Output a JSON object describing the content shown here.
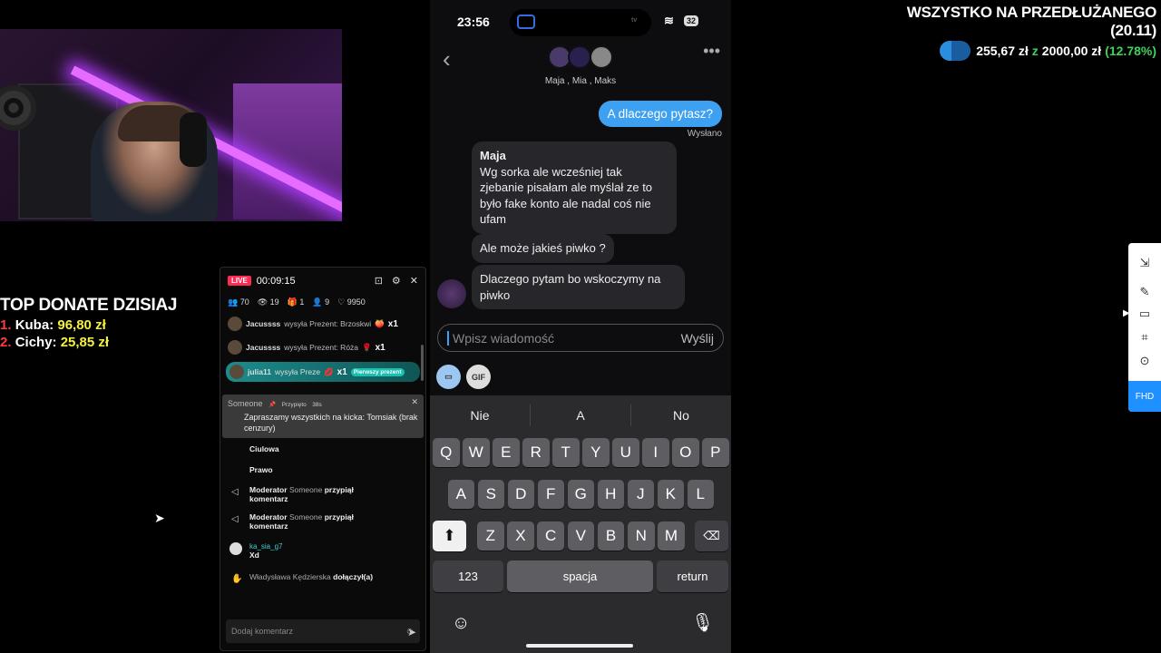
{
  "donate": {
    "title": "TOP DONATE DZISIAJ",
    "entries": [
      {
        "rank": "1.",
        "name": "Kuba:",
        "amount": "96,80 zł"
      },
      {
        "rank": "2.",
        "name": "Cichy:",
        "amount": "25,85 zł"
      }
    ]
  },
  "goal": {
    "title": "WSZYSTKO NA PRZEDŁUŻANEGO (20.11)",
    "current": "255,67 zł",
    "sep": "z",
    "target": "2000,00 zł",
    "percent": "(12.78%)",
    "progress": 0.1278
  },
  "live_panel": {
    "live_badge": "LIVE",
    "timer": "00:09:15",
    "stats": {
      "viewers": "70",
      "views": "19",
      "gifts": "1",
      "shares": "9",
      "likes": "9950"
    },
    "gifts": [
      {
        "user": "Jacussss",
        "text": "wysyła Prezent: Brzoskwi",
        "count": "x1"
      },
      {
        "user": "Jacussss",
        "text": "wysyła Prezent: Róża",
        "count": "x1"
      },
      {
        "user": "julia11",
        "text": "wysyła Preze",
        "count": "x1",
        "badge": "Pierwszy prezent"
      }
    ],
    "pinned": {
      "user": "Someone",
      "tag": "Przypięto",
      "age": "38s",
      "text": "Zapraszamy wszystkich na kicka: Tomsiak (brak cenzury)"
    },
    "messages": [
      {
        "user": "",
        "text": "Ciulowa"
      },
      {
        "user": "",
        "text": "Prawo"
      },
      {
        "user": "Moderator",
        "who": "Someone",
        "action": "przypiął",
        "text": "komentarz"
      },
      {
        "user": "Moderator",
        "who": "Someone",
        "action": "przypiął",
        "text": "komentarz"
      },
      {
        "user": "ka_sia_g7",
        "text": "Xd"
      },
      {
        "user": "Władysława Kędzierska",
        "action": "dołączył(a)"
      }
    ],
    "comment_placeholder": "Dodaj komentarz"
  },
  "phone": {
    "time": "23:56",
    "battery": "32",
    "tv_label": "tv",
    "group_names": "Maja , Mia , Maks",
    "my_message": "A dlaczego pytasz?",
    "sent_status": "Wysłano",
    "incoming": [
      {
        "sender": "Maja",
        "text": "Wg sorka ale wcześniej tak zjebanie pisałam ale myślał ze to było fake konto ale nadal coś nie ufam"
      },
      {
        "sender": "",
        "text": "Ale może jakieś piwko ?"
      },
      {
        "sender": "",
        "text": "Dlaczego pytam bo wskoczymy na piwko"
      }
    ],
    "input_placeholder": "Wpisz wiadomość",
    "send_label": "Wyślij",
    "gif_label": "GIF",
    "suggestions": [
      "Nie",
      "A",
      "No"
    ],
    "keys_row1": [
      "Q",
      "W",
      "E",
      "R",
      "T",
      "Y",
      "U",
      "I",
      "O",
      "P"
    ],
    "keys_row2": [
      "A",
      "S",
      "D",
      "F",
      "G",
      "H",
      "J",
      "K",
      "L"
    ],
    "keys_row3": [
      "Z",
      "X",
      "C",
      "V",
      "B",
      "N",
      "M"
    ],
    "key_123": "123",
    "key_space": "spacja",
    "key_return": "return"
  },
  "right_toolbar": {
    "fhd": "FHD"
  }
}
